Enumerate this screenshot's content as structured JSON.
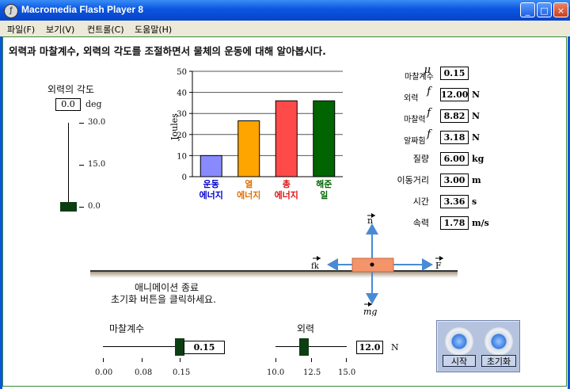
{
  "window": {
    "title": "Macromedia Flash Player 8",
    "minimize": "_",
    "maximize": "□",
    "close": "×"
  },
  "menu": [
    "파일(F)",
    "보기(V)",
    "컨트롤(C)",
    "도움말(H)"
  ],
  "heading": "외력과 마찰계수, 외력의 각도를 조절하면서 물체의 운동에 대해 알아봅시다.",
  "angle": {
    "label": "외력의 각도",
    "value": "0.0",
    "unit": "deg",
    "ticks": [
      "30.0",
      "15.0",
      "0.0"
    ],
    "level_fraction": 0.0
  },
  "chart_data": {
    "type": "bar",
    "ylabel": "Joules",
    "ylim": [
      0,
      50
    ],
    "yticks": [
      "50",
      "40",
      "30",
      "20",
      "10",
      "0"
    ],
    "categories": [
      {
        "line1": "운동",
        "line2": "에너지",
        "color": "#0000cc"
      },
      {
        "line1": "열",
        "line2": "에너지",
        "color": "#e07000"
      },
      {
        "line1": "총",
        "line2": "에너지",
        "color": "#e01010"
      },
      {
        "line1": "해준",
        "line2": "일",
        "color": "#006400"
      }
    ],
    "values": [
      10,
      26.5,
      36,
      36
    ],
    "colors": [
      "#8a8aff",
      "#ffa500",
      "#ff4a4a",
      "#006400"
    ]
  },
  "readouts": [
    {
      "sym": "μ",
      "label": "마찰계수",
      "value": "0.15",
      "unit": ""
    },
    {
      "sym": "f",
      "label": "외력",
      "value": "12.00",
      "unit": "N"
    },
    {
      "sym": "f",
      "label": "마찰력",
      "value": "8.82",
      "unit": "N"
    },
    {
      "sym": "f",
      "label": "알짜힘",
      "value": "3.18",
      "unit": "N"
    },
    {
      "sym": "",
      "label": "질량",
      "value": "6.00",
      "unit": "kg"
    },
    {
      "sym": "",
      "label": "이동거리",
      "value": "3.00",
      "unit": "m"
    },
    {
      "sym": "",
      "label": "시간",
      "value": "3.36",
      "unit": "s"
    },
    {
      "sym": "",
      "label": "속력",
      "value": "1.78",
      "unit": "m/s"
    }
  ],
  "diagram": {
    "n": "n",
    "mg": "mg",
    "fk": "fk",
    "F": "F"
  },
  "message": {
    "line1": "애니메이션 종료",
    "line2": "초기화 버튼을 클릭하세요."
  },
  "friction": {
    "label": "마찰계수",
    "value": "0.15",
    "ticks": [
      "0.00",
      "0.08",
      "0.15"
    ],
    "level_fraction": 1.0
  },
  "force": {
    "label": "외력",
    "value": "12.0",
    "unit": "N",
    "ticks": [
      "10.0",
      "12.5",
      "15.0"
    ],
    "level_fraction": 0.4
  },
  "buttons": {
    "start": "시작",
    "reset": "초기화"
  }
}
